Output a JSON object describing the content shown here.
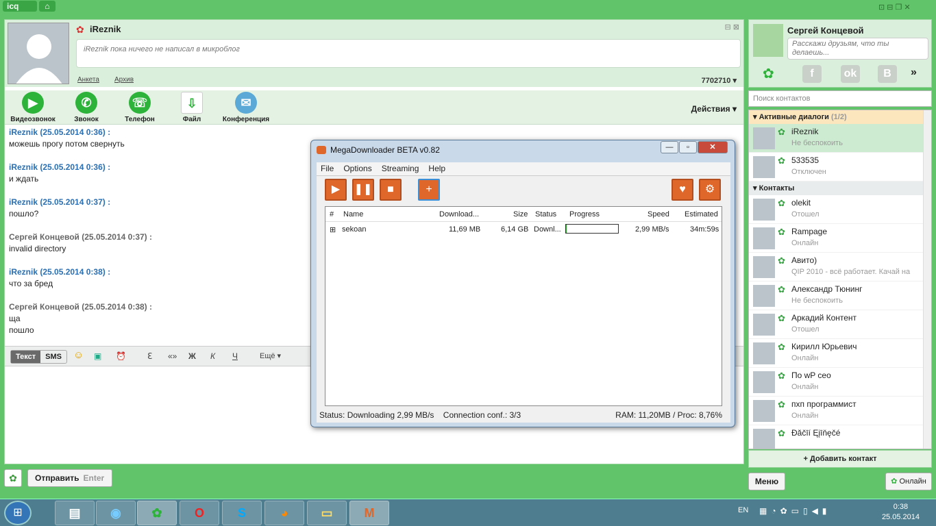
{
  "icq": {
    "logo": "icq",
    "home": "⌂",
    "wctl": "⊡ ⊟ ❐ ✕"
  },
  "profile": {
    "name": "iReznik",
    "microblog": "iReznik пока ничего не написал в микроблог",
    "link_profile": "Анкета",
    "link_archive": "Архив",
    "uin": "7702710 ▾",
    "close": "⊟ ⊠"
  },
  "toolbar": {
    "items": [
      {
        "label": "Видеозвонок",
        "icon": "▶"
      },
      {
        "label": "Звонок",
        "icon": "✆"
      },
      {
        "label": "Телефон",
        "icon": "☏"
      },
      {
        "label": "Файл",
        "icon": "⇩"
      },
      {
        "label": "Конференция",
        "icon": "✉"
      }
    ],
    "actions": "Действия ▾"
  },
  "messages": [
    {
      "header": "iReznik (25.05.2014 0:36) :",
      "lines": [
        "можешь прогу потом свернуть"
      ],
      "me": true
    },
    {
      "header": "iReznik (25.05.2014 0:36) :",
      "lines": [
        "и ждать"
      ],
      "me": true
    },
    {
      "header": "iReznik (25.05.2014 0:37) :",
      "lines": [
        "пошло?"
      ],
      "me": true
    },
    {
      "header": "Сергей Концевой (25.05.2014 0:37) :",
      "lines": [
        "invalid directory"
      ],
      "me": false
    },
    {
      "header": "iReznik (25.05.2014 0:38) :",
      "lines": [
        "что за бред"
      ],
      "me": true
    },
    {
      "header": "Сергей Концевой (25.05.2014 0:38) :",
      "lines": [
        "ща",
        "пошло"
      ],
      "me": false
    }
  ],
  "format": {
    "text_tab": "Текст",
    "sms_tab": "SMS",
    "bold": "Ж",
    "italic": "К",
    "underline": "Ч",
    "quote": "«»",
    "more": "Ещё ▾",
    "translit": "Ꜫ"
  },
  "send": {
    "label": "Отправить",
    "key": "Enter"
  },
  "self": {
    "name": "Сергей Концевой",
    "status_placeholder": "Расскажи друзьям, что ты делаешь...",
    "more": "»"
  },
  "search_placeholder": "Поиск контактов",
  "groups": {
    "active": "▾ Активные диалоги",
    "active_count": "(1/2)",
    "contacts": "▾ Контакты"
  },
  "active_dialogs": [
    {
      "name": "iReznik",
      "status": "Не беспокоить",
      "selected": true
    },
    {
      "name": "533535",
      "status": "Отключен",
      "selected": false
    }
  ],
  "contacts": [
    {
      "name": "olekit",
      "status": "Отошел"
    },
    {
      "name": "Rampage",
      "status": "Онлайн"
    },
    {
      "name": "Авито)",
      "status": "QIP 2010 - всё работает. Качай на"
    },
    {
      "name": "Александр Тюнинг",
      "status": "Не беспокоить"
    },
    {
      "name": "Аркадий Контент",
      "status": "Отошел"
    },
    {
      "name": "Кирилл Юрьевич",
      "status": "Онлайн"
    },
    {
      "name": "По wP ceo",
      "status": "Онлайн"
    },
    {
      "name": "пхп программист",
      "status": "Онлайн"
    },
    {
      "name": "Đăčīí Ęįīňęčé",
      "status": ""
    }
  ],
  "add_contact": "+ Добавить контакт",
  "menu_btn": "Меню",
  "online_btn": "Онлайн",
  "mega": {
    "title": "MegaDownloader BETA v0.82",
    "menu": [
      "File",
      "Options",
      "Streaming",
      "Help"
    ],
    "columns": [
      "#",
      "Name",
      "Download...",
      "Size",
      "Status",
      "Progress",
      "Speed",
      "Estimated"
    ],
    "row": {
      "name": "sekoan",
      "downloaded": "11,69 MB",
      "size": "6,14 GB",
      "status": "Downl...",
      "progress": 0.002,
      "speed": "2,99 MB/s",
      "estimated": "34m:59s"
    },
    "status_left": "Status: Downloading 2,99 MB/s",
    "status_mid": "Connection conf.: 3/3",
    "status_right": "RAM: 11,20MB / Proc: 8,76%"
  },
  "taskbar": {
    "lang": "EN",
    "time": "0:38",
    "date": "25.05.2014"
  }
}
